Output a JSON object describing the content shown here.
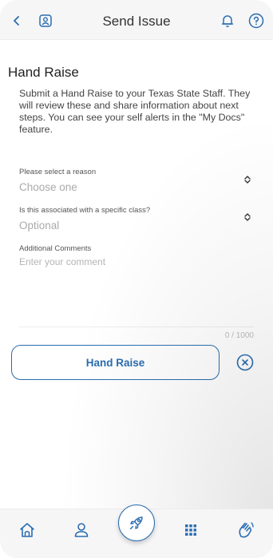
{
  "header": {
    "title": "Send Issue",
    "back_icon": "chevron-left-icon",
    "contact_icon": "contact-card-icon",
    "bell_icon": "bell-icon",
    "help_icon": "help-circle-icon"
  },
  "page": {
    "title": "Hand Raise",
    "description": "Submit a Hand Raise to your Texas State Staff. They will review these and share information about next steps. You can see your self alerts in the \"My Docs\" feature."
  },
  "form": {
    "reason": {
      "label": "Please select a reason",
      "value": "Choose one"
    },
    "class": {
      "label": "Is this associated with a specific class?",
      "value": "Optional"
    },
    "comments": {
      "label": "Additional Comments",
      "placeholder": "Enter your comment",
      "count": "0 / 1000"
    },
    "submit_label": "Hand Raise",
    "clear_icon": "close-circle-icon"
  },
  "bottom_nav": {
    "items": [
      "home-icon",
      "profile-icon",
      "rocket-icon",
      "apps-grid-icon",
      "hand-raise-icon"
    ]
  },
  "colors": {
    "accent": "#2a6db0",
    "header_bg": "#f6f6f7",
    "placeholder": "#aaaaaa"
  }
}
